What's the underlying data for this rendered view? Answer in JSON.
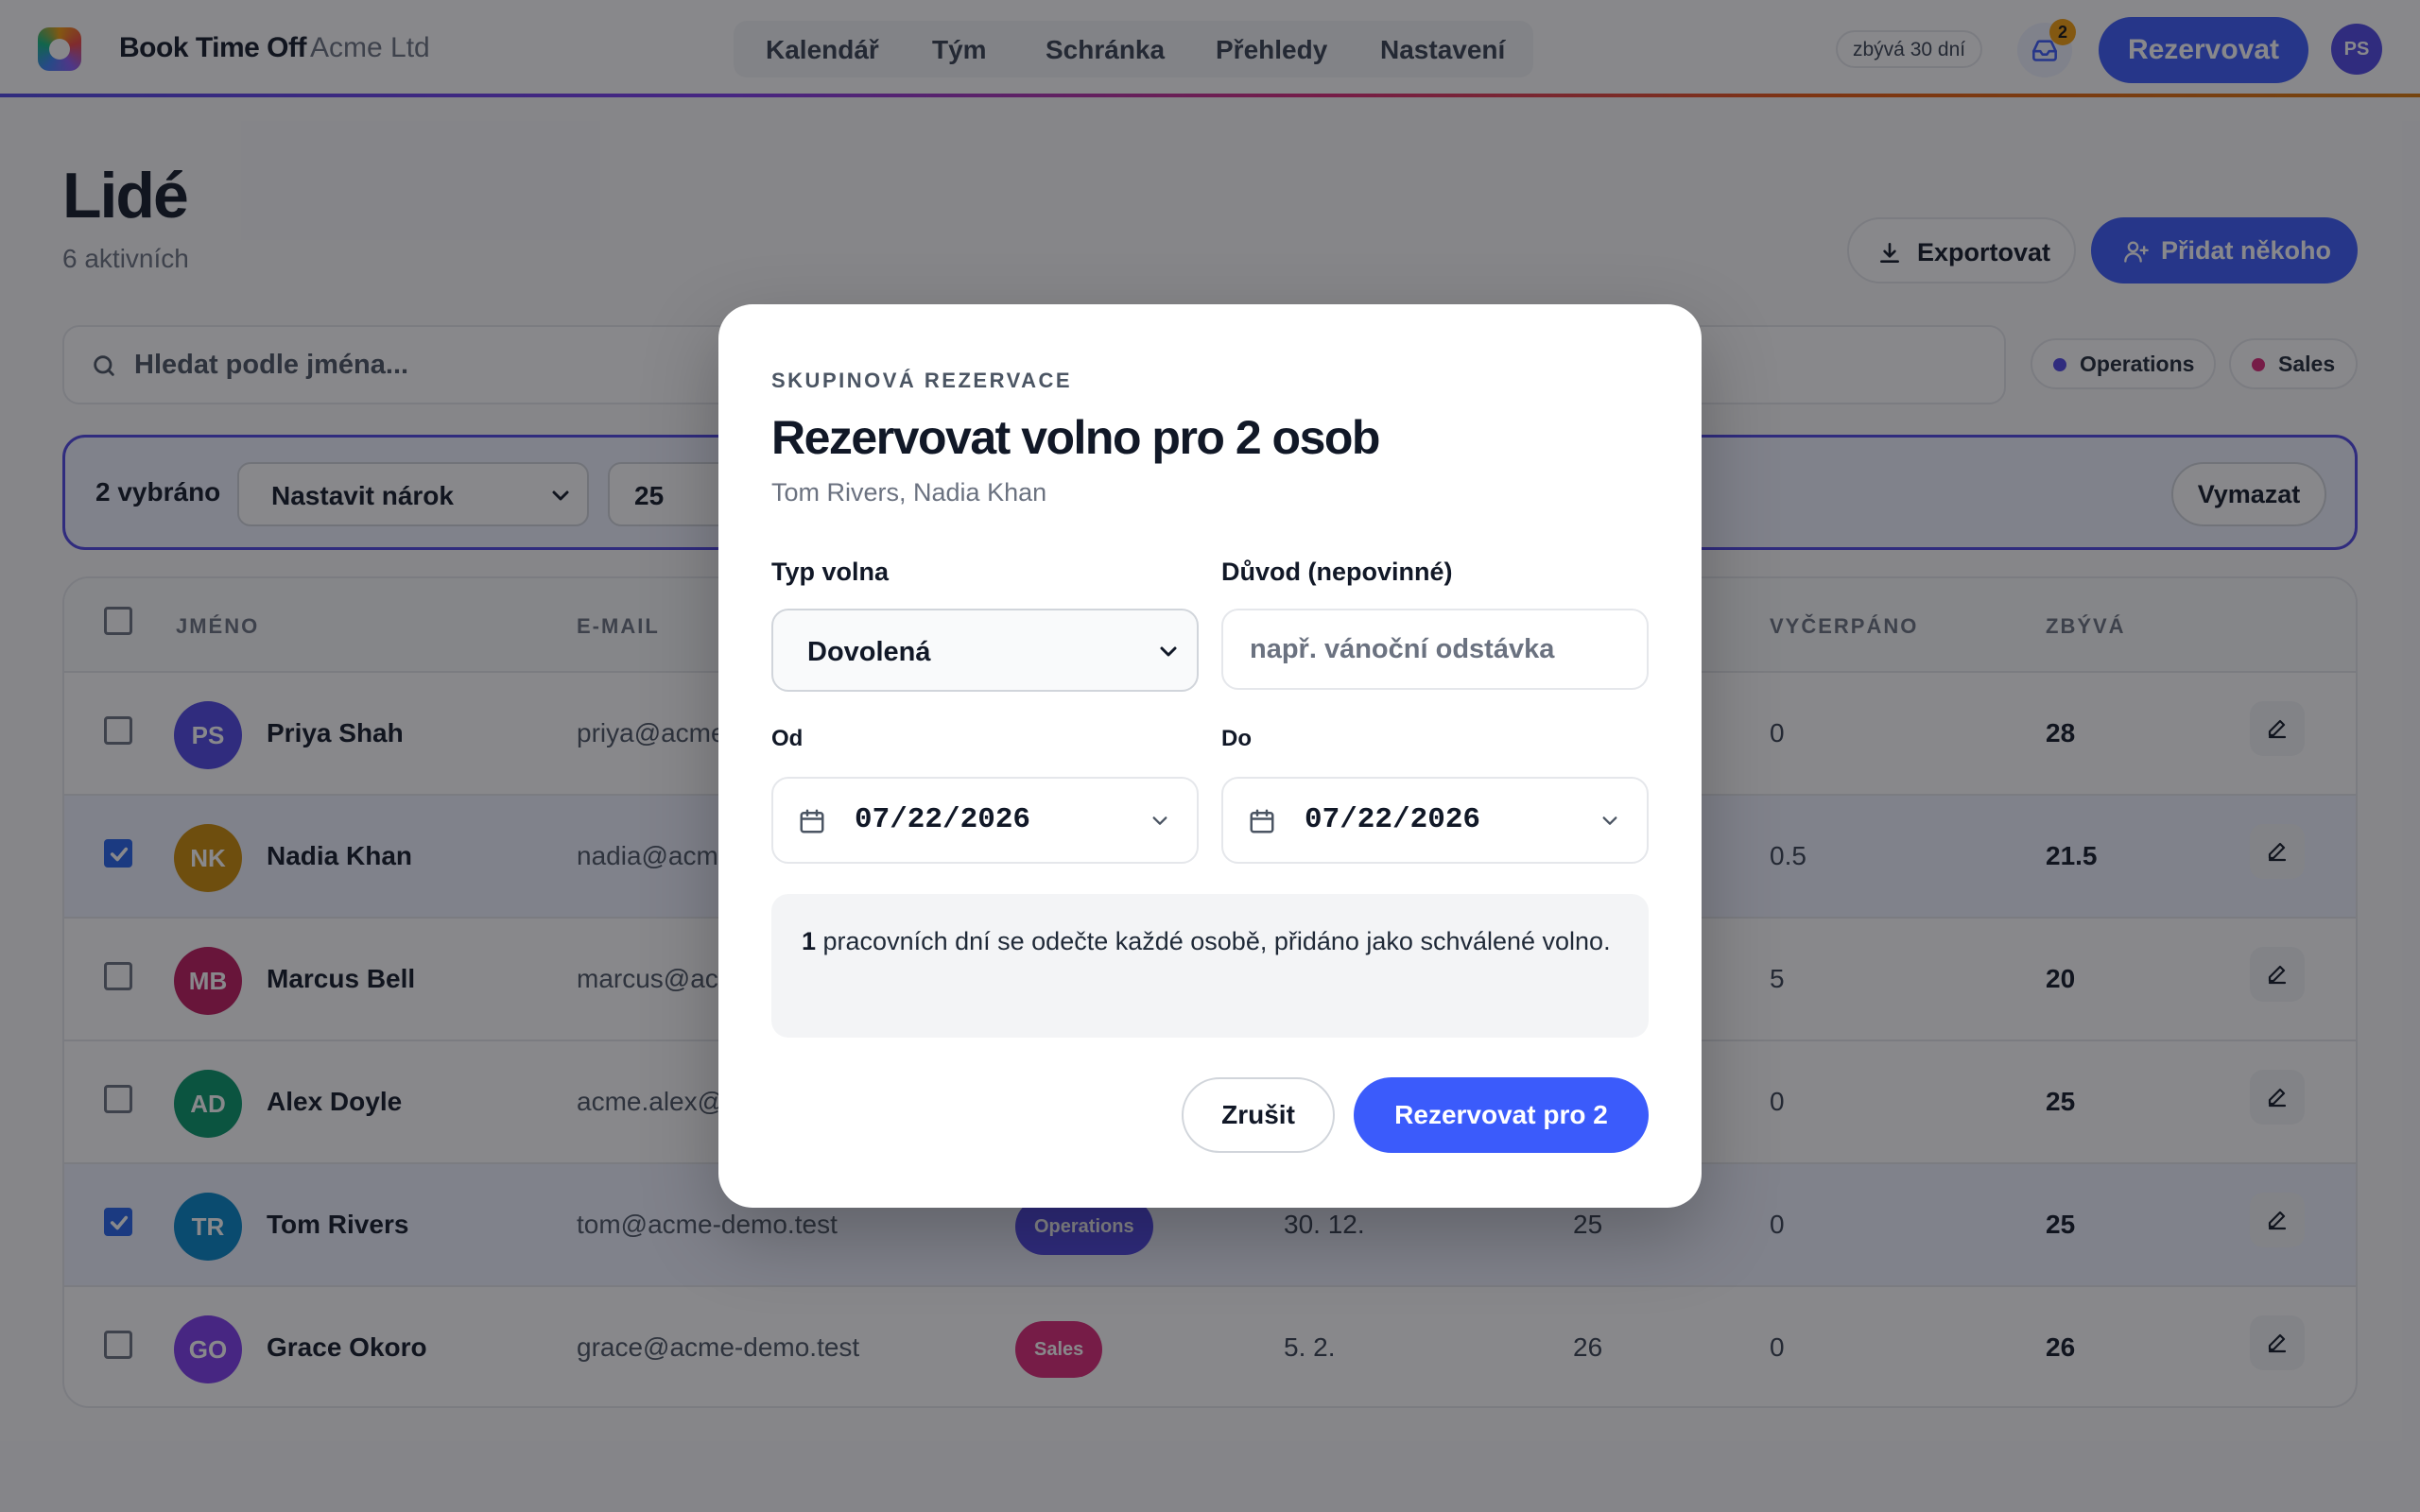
{
  "topbar": {
    "brand": "Book Time Off",
    "org": "Acme Ltd",
    "nav": [
      "Kalendář",
      "Tým",
      "Schránka",
      "Přehledy",
      "Nastavení"
    ],
    "trial": "zbývá 30 dní",
    "inbox_count": "2",
    "book_label": "Rezervovat",
    "user_initials": "PS"
  },
  "page": {
    "title": "Lidé",
    "subtitle": "6 aktivních",
    "export_label": "Exportovat",
    "add_label": "Přidat někoho"
  },
  "search": {
    "placeholder": "Hledat podle jména..."
  },
  "filters": [
    {
      "label": "Operations",
      "color": "#4f46e5"
    },
    {
      "label": "Sales",
      "color": "#db2777"
    }
  ],
  "bulk": {
    "count": "2 vybráno",
    "action": "Nastavit nárok",
    "amount": "25",
    "clear_label": "Vymazat"
  },
  "table": {
    "headers": {
      "name": "JMÉNO",
      "email": "E-MAIL",
      "used": "VYČERPÁNO",
      "left": "ZBÝVÁ"
    },
    "rows": [
      {
        "initials": "PS",
        "name": "Priya Shah",
        "email": "priya@acme-demo.test",
        "team": "",
        "date": "",
        "allowance": "",
        "used": "0",
        "left": "28",
        "selected": false,
        "color": "#4f46e5"
      },
      {
        "initials": "NK",
        "name": "Nadia Khan",
        "email": "nadia@acme-demo.test",
        "team": "",
        "date": "",
        "allowance": "",
        "used": "0.5",
        "left": "21.5",
        "selected": true,
        "color": "#ca8a04"
      },
      {
        "initials": "MB",
        "name": "Marcus Bell",
        "email": "marcus@acme-demo.test",
        "team": "",
        "date": "",
        "allowance": "",
        "used": "5",
        "left": "20",
        "selected": false,
        "color": "#be185d"
      },
      {
        "initials": "AD",
        "name": "Alex Doyle",
        "email": "acme.alex@acme-demo.test",
        "team": "",
        "date": "",
        "allowance": "",
        "used": "0",
        "left": "25",
        "selected": false,
        "color": "#059669"
      },
      {
        "initials": "TR",
        "name": "Tom Rivers",
        "email": "tom@acme-demo.test",
        "team": "Operations",
        "date": "30. 12.",
        "allowance": "25",
        "used": "0",
        "left": "25",
        "selected": true,
        "color": "#0284c7",
        "team_color": "#4f46e5"
      },
      {
        "initials": "GO",
        "name": "Grace Okoro",
        "email": "grace@acme-demo.test",
        "team": "Sales",
        "date": "5. 2.",
        "allowance": "26",
        "used": "0",
        "left": "26",
        "selected": false,
        "color": "#7c3aed",
        "team_color": "#db2777"
      }
    ]
  },
  "modal": {
    "eyebrow": "SKUPINOVÁ REZERVACE",
    "title": "Rezervovat volno pro 2 osob",
    "people": "Tom Rivers, Nadia Khan",
    "type_label": "Typ volna",
    "type_value": "Dovolená",
    "reason_label": "Důvod (nepovinné)",
    "reason_placeholder": "např. vánoční odstávka",
    "from_label": "Od",
    "from_value": "07/22/2026",
    "to_label": "Do",
    "to_value": "07/22/2026",
    "info_count": "1",
    "info_text": " pracovních dní se odečte každé osobě, přidáno jako schválené volno.",
    "cancel_label": "Zrušit",
    "submit_label": "Rezervovat pro 2"
  }
}
